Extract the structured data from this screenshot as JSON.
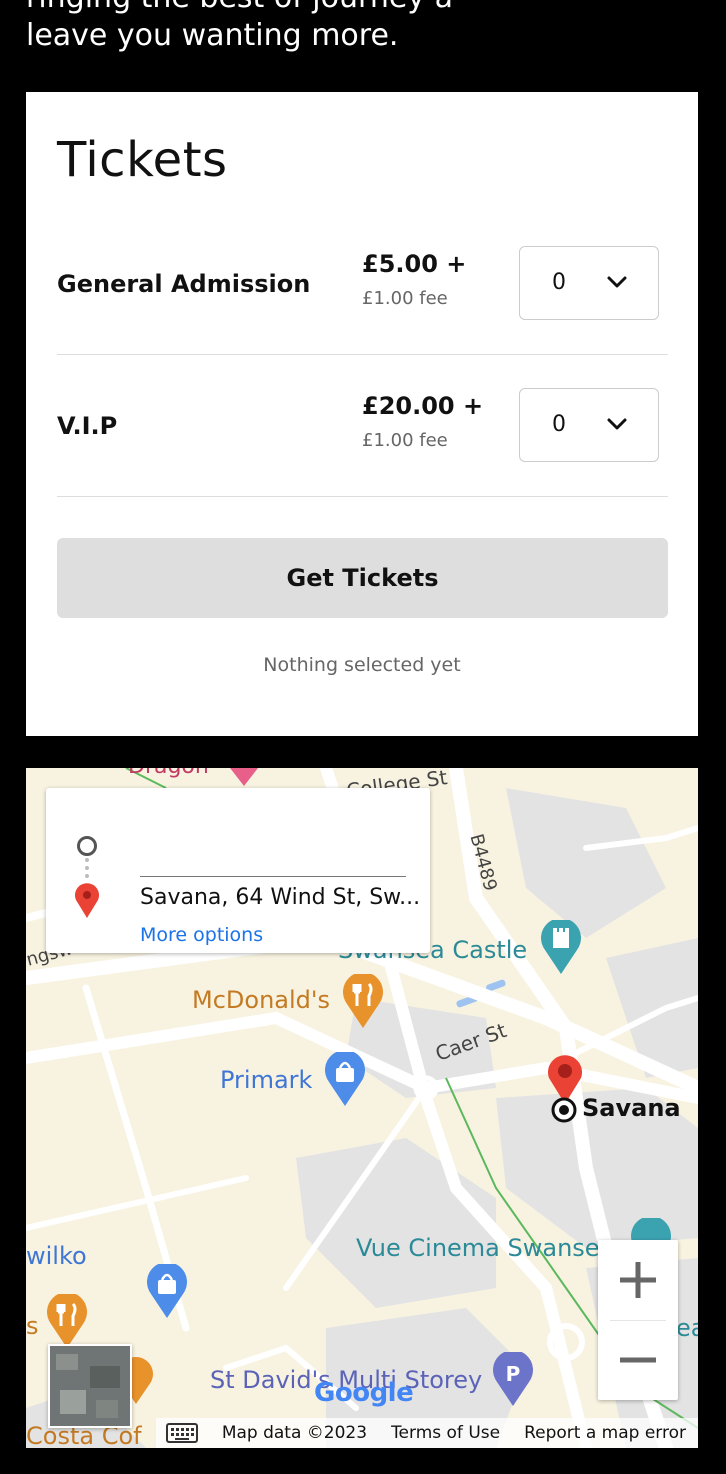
{
  "intro": {
    "partial_line": "ringing the best of journey a",
    "line2": "leave you wanting more."
  },
  "tickets": {
    "title": "Tickets",
    "rows": [
      {
        "name": "General Admission",
        "price": "£5.00 +",
        "fee": "£1.00 fee",
        "quantity": "0"
      },
      {
        "name": "V.I.P",
        "price": "£20.00 +",
        "fee": "£1.00 fee",
        "quantity": "0"
      }
    ],
    "button_label": "Get Tickets",
    "status": "Nothing selected yet"
  },
  "map": {
    "route_card": {
      "destination": "Savana, 64 Wind St, Sw...",
      "more_options": "More options"
    },
    "labels": {
      "dragon": "Dragon",
      "college_st": "College St",
      "b4489": "B4489",
      "swansea_castle": "Swansea Castle",
      "mcdonalds": "McDonald's",
      "primark": "Primark",
      "caer_st": "Caer St",
      "savana": "Savana",
      "wilko": "wilko",
      "vue": "Vue Cinema Swansea",
      "st_davids": "St David's Multi Storey",
      "costa": "Costa Cof",
      "kingsway": "ngsw",
      "ea": "ea",
      "s": "s"
    },
    "zoom_in_icon": "plus-icon",
    "zoom_out_icon": "minus-icon",
    "google_logo": "Google",
    "attribution": {
      "map_data": "Map data ©2023",
      "terms": "Terms of Use",
      "report": "Report a map error"
    },
    "colors": {
      "background": "#f8f3e1",
      "road": "#ffffff",
      "building": "#e3e3e3",
      "pin_red": "#ea4335",
      "poi_orange": "#e8922c",
      "poi_blue": "#4d8de9",
      "poi_teal": "#3ba2b0"
    }
  }
}
